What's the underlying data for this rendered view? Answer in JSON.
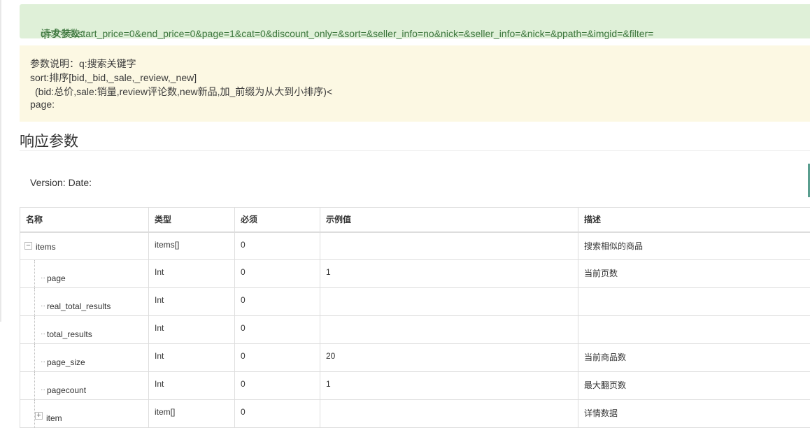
{
  "request": {
    "label": "请求参数：",
    "value": "q=女装&start_price=0&end_price=0&page=1&cat=0&discount_only=&sort=&seller_info=no&nick=&seller_info=&nick=&ppath=&imgid=&filter="
  },
  "params": {
    "line1": "参数说明：q:搜索关键字",
    "line2": "sort:排序[bid,_bid,_sale,_review,_new]",
    "line3": "(bid:总价,sale:销量,review评论数,new新品,加_前缀为从大到小排序)<",
    "line4": "page:"
  },
  "section_title": "响应参数",
  "version": {
    "version_label": "Version:",
    "date_label": "Date:"
  },
  "table": {
    "headers": {
      "name": "名称",
      "type": "类型",
      "required": "必须",
      "example": "示例值",
      "desc": "描述"
    },
    "rows": [
      {
        "name": "items",
        "type": "items[]",
        "required": "0",
        "example": "",
        "desc": "搜索相似的商品",
        "toggle": "−"
      },
      {
        "name": "page",
        "type": "Int",
        "required": "0",
        "example": "1",
        "desc": "当前页数"
      },
      {
        "name": "real_total_results",
        "type": "Int",
        "required": "0",
        "example": "",
        "desc": ""
      },
      {
        "name": "total_results",
        "type": "Int",
        "required": "0",
        "example": "",
        "desc": ""
      },
      {
        "name": "page_size",
        "type": "Int",
        "required": "0",
        "example": "20",
        "desc": "当前商品数"
      },
      {
        "name": "pagecount",
        "type": "Int",
        "required": "0",
        "example": "1",
        "desc": "最大翻页数"
      },
      {
        "name": "item",
        "type": "item[]",
        "required": "0",
        "example": "",
        "desc": "详情数据",
        "toggle": "+"
      }
    ]
  }
}
